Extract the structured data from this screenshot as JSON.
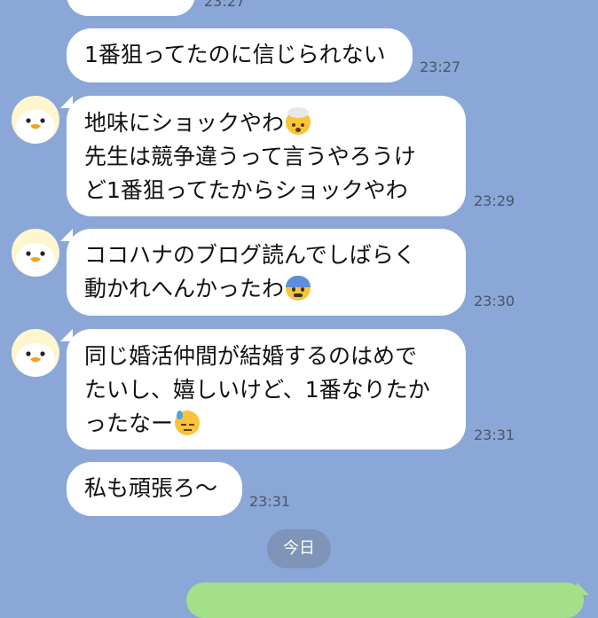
{
  "messages": [
    {
      "lines": [
        ""
      ],
      "time": "23:27"
    },
    {
      "lines": [
        "1番狙ってたのに信じられない"
      ],
      "time": "23:27"
    },
    {
      "lines": [
        "地味にショックやわ",
        "先生は競争違うって言うやろうけ",
        "ど1番狙ってたからショックやわ"
      ],
      "time": "23:29"
    },
    {
      "lines": [
        "ココハナのブログ読んでしばらく",
        "動かれへんかったわ"
      ],
      "time": "23:30"
    },
    {
      "lines": [
        "同じ婚活仲間が結婚するのはめで",
        "たいし、嬉しいけど、1番なりたか",
        "ったなー"
      ],
      "time": "23:31"
    },
    {
      "lines": [
        "私も頑張ろ〜"
      ],
      "time": "23:31"
    }
  ],
  "date_divider": "今日",
  "emojis": {
    "m2": "exploding-head",
    "m3": "fearful-face",
    "m4": "downcast-sweat"
  },
  "colors": {
    "background": "#8aa7d7",
    "bubble": "#ffffff",
    "own_bubble": "#a4e08a",
    "pill": "#7e94b9"
  }
}
